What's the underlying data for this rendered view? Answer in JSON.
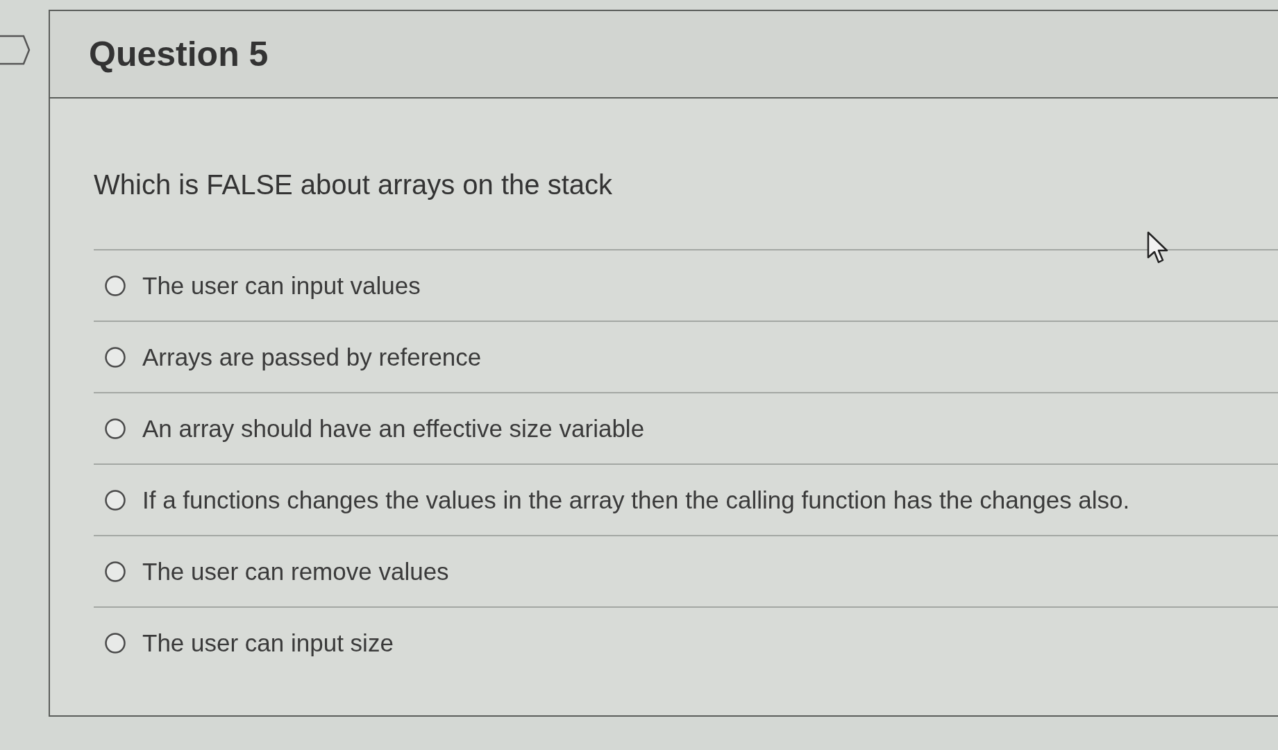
{
  "question": {
    "title": "Question 5",
    "prompt": "Which is FALSE about arrays on the stack"
  },
  "options": [
    {
      "label": "The user can input values",
      "selected": false
    },
    {
      "label": "Arrays are passed by reference",
      "selected": false
    },
    {
      "label": "An array should have an effective size variable",
      "selected": false
    },
    {
      "label": "If a functions changes the values in the array then the calling function has the changes also.",
      "selected": false
    },
    {
      "label": "The user can remove values",
      "selected": false
    },
    {
      "label": "The user can input size",
      "selected": false
    }
  ]
}
